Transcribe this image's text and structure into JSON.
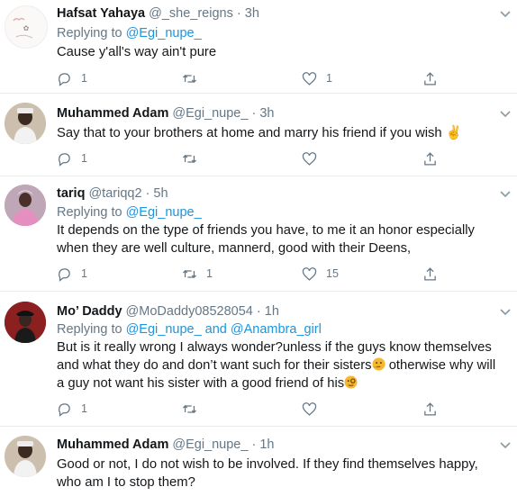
{
  "tweets": [
    {
      "name": "Hafsat Yahaya",
      "handle": "@_she_reigns",
      "sep": "·",
      "time": "3h",
      "replying_prefix": "Replying to ",
      "replying_to": "@Egi_nupe_",
      "text": "Cause y'all's way ain't pure",
      "reply_count": "1",
      "retweet_count": "",
      "like_count": "1"
    },
    {
      "name": "Muhammed Adam",
      "handle": "@Egi_nupe_",
      "sep": "·",
      "time": "3h",
      "text": "Say that to your brothers at home and marry his friend if you wish",
      "emoji": "✌",
      "reply_count": "1",
      "retweet_count": "",
      "like_count": ""
    },
    {
      "name": "tariq",
      "handle": "@tariqq2",
      "sep": "·",
      "time": "5h",
      "replying_prefix": "Replying to ",
      "replying_to": "@Egi_nupe_",
      "text_line1": "It depends on the type of friends you have, to me it an honor especially",
      "text_line2": "when they are well culture, mannerd, good with their Deens,",
      "reply_count": "1",
      "retweet_count": "1",
      "like_count": "15"
    },
    {
      "name": "Mo’ Daddy",
      "handle": "@MoDaddy08528054",
      "sep": "·",
      "time": "1h",
      "replying_prefix": "Replying to ",
      "replying_to": "@Egi_nupe_",
      "replying_and": " and ",
      "replying_to2": "@Anambra_girl",
      "text_line1": "But is it really wrong I always wonder?unless if the guys know themselves",
      "text_line2a": "and what they do and don’t want such for their sisters",
      "text_line2b": " otherwise why will",
      "text_line3": "a guy not want his sister with a good friend of his",
      "reply_count": "1",
      "retweet_count": "",
      "like_count": ""
    },
    {
      "name": "Muhammed Adam",
      "handle": "@Egi_nupe_",
      "sep": "·",
      "time": "1h",
      "text_line1": "Good or not, I do not wish to be involved. If they find themselves happy,",
      "text_line2": "who am I to stop them?"
    }
  ]
}
